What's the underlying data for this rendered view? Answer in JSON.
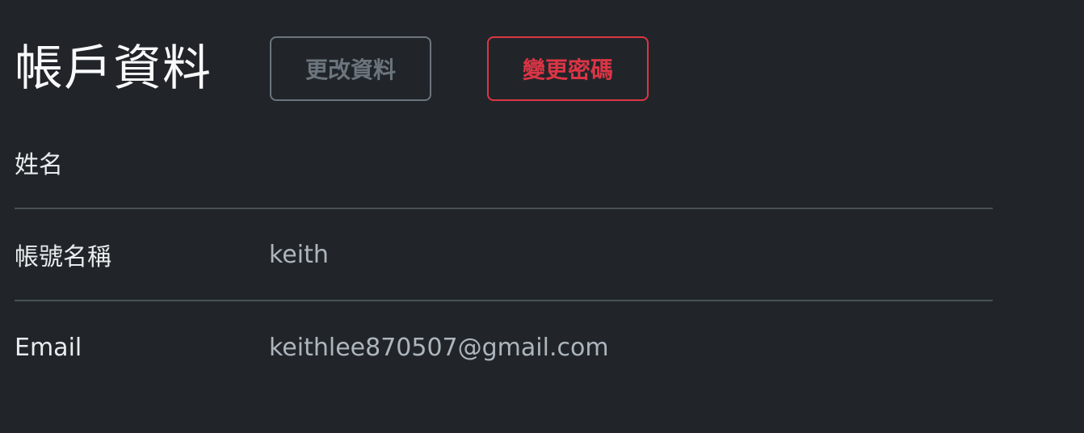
{
  "header": {
    "title": "帳戶資料",
    "edit_button": "更改資料",
    "change_password_button": "變更密碼"
  },
  "colors": {
    "background": "#212529",
    "secondary": "#6c757d",
    "danger": "#dc3545",
    "divider": "#495057"
  },
  "profile": {
    "rows": [
      {
        "label": "姓名",
        "value": ""
      },
      {
        "label": "帳號名稱",
        "value": "keith"
      },
      {
        "label": "Email",
        "value": "keithlee870507@gmail.com"
      }
    ]
  }
}
